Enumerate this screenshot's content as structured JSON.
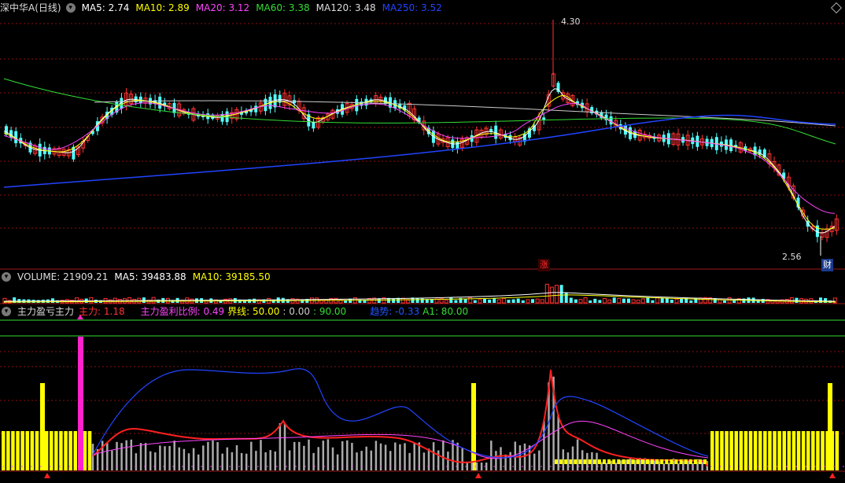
{
  "header": {
    "title": "深中华A(日线)",
    "ma": [
      {
        "label": "MA5: 2.74",
        "color": "#ffffff"
      },
      {
        "label": "MA10: 2.89",
        "color": "#ffff00"
      },
      {
        "label": "MA20: 3.12",
        "color": "#ff44ff"
      },
      {
        "label": "MA60: 3.38",
        "color": "#33dd33"
      },
      {
        "label": "MA120: 3.48",
        "color": "#dddddd"
      },
      {
        "label": "MA250: 3.52",
        "color": "#2244ff"
      }
    ]
  },
  "price_annotations": {
    "high": "4.30",
    "low": "2.56",
    "up_tag": "涨",
    "fin_tag": "财"
  },
  "volume": {
    "label": "VOLUME: 21909.21",
    "ma5": "MA5: 39483.88",
    "ma10": "MA10: 39185.50"
  },
  "indicator": {
    "name": "主力盈亏主力",
    "main": "主力: 1.18",
    "ratio": "主力盈利比例: 0.49",
    "bound": "界线: 50.00",
    "v1": ": 0.00",
    "v2": ": 90.00",
    "trend": "趋势: -0.33",
    "a1": "A1: 80.00"
  },
  "colors": {
    "up": "#ff3232",
    "down": "#54ffff",
    "grid": "#8a1010"
  }
}
